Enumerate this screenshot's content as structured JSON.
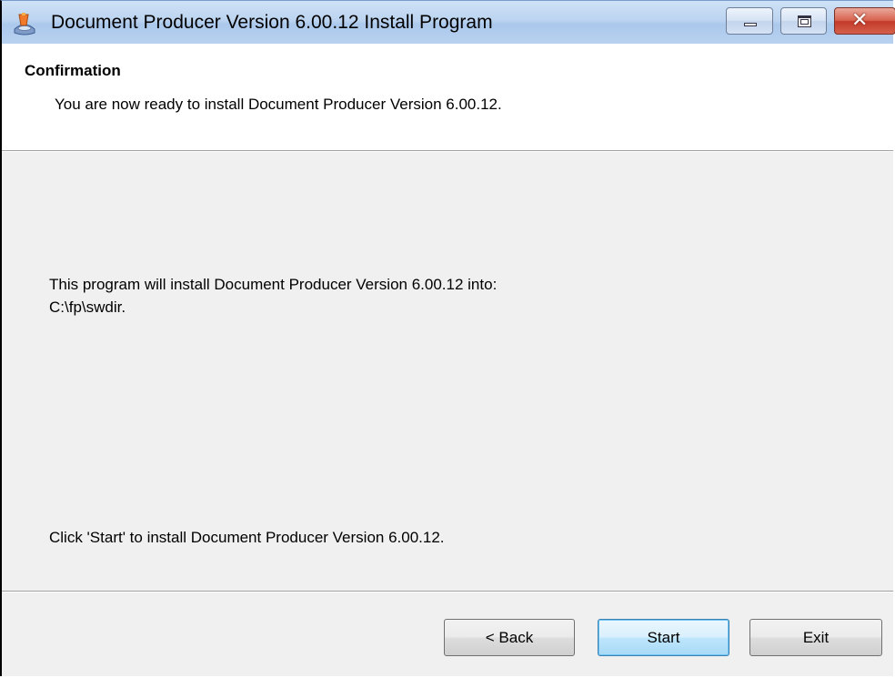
{
  "window": {
    "title": "Document Producer Version 6.00.12 Install Program",
    "icon": "installer-app-icon",
    "controls": {
      "minimize_icon": "minimize-icon",
      "maximize_icon": "maximize-icon",
      "close_icon": "close-icon",
      "close_glyph": "✕",
      "close_color": "#c3392a"
    }
  },
  "header": {
    "title": "Confirmation",
    "subtitle": "You are now ready to install Document Producer Version 6.00.12."
  },
  "body": {
    "install_line1": "This program will install Document Producer Version 6.00.12 into:",
    "install_path": "C:\\fp\\swdir.",
    "start_hint": "Click 'Start' to install Document Producer Version 6.00.12."
  },
  "buttons": {
    "back_label": "< Back",
    "start_label": "Start",
    "exit_label": "Exit"
  }
}
